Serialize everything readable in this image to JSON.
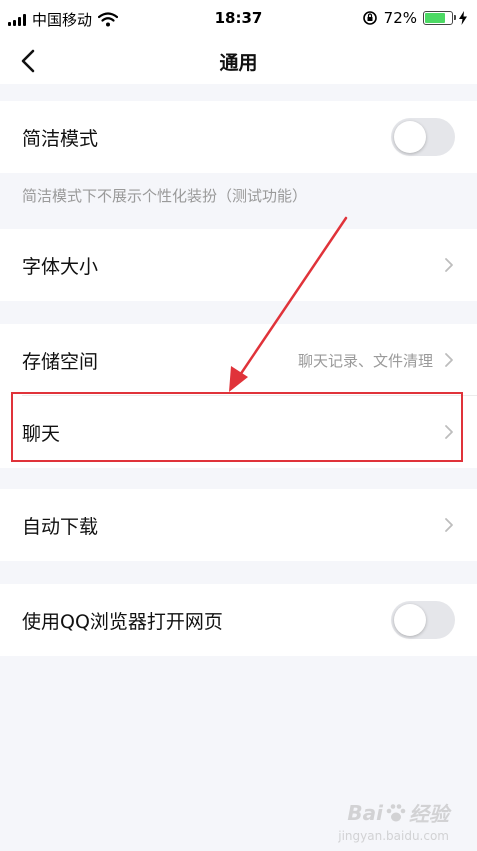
{
  "status_bar": {
    "carrier": "中国移动",
    "time": "18:37",
    "battery_percent": "72%",
    "battery_level": 0.72,
    "battery_color": "#4cd964"
  },
  "nav": {
    "title": "通用",
    "back_icon": "chevron-left-icon"
  },
  "settings": {
    "simple_mode": {
      "label": "简洁模式",
      "enabled": false
    },
    "simple_mode_hint": "简洁模式下不展示个性化装扮（测试功能）",
    "font_size": {
      "label": "字体大小"
    },
    "storage": {
      "label": "存储空间",
      "subtitle": "聊天记录、文件清理"
    },
    "chat": {
      "label": "聊天"
    },
    "auto_download": {
      "label": "自动下载"
    },
    "qq_browser": {
      "label": "使用QQ浏览器打开网页",
      "enabled": false
    }
  },
  "annotation": {
    "highlight_color": "#e0333a"
  },
  "watermark": {
    "brand": "Bai",
    "brand_suffix": "经验",
    "url": "jingyan.baidu.com"
  },
  "colors": {
    "background": "#f5f6fa",
    "toggle_off": "#e5e6ea",
    "secondary_text": "#9a9a9a"
  }
}
